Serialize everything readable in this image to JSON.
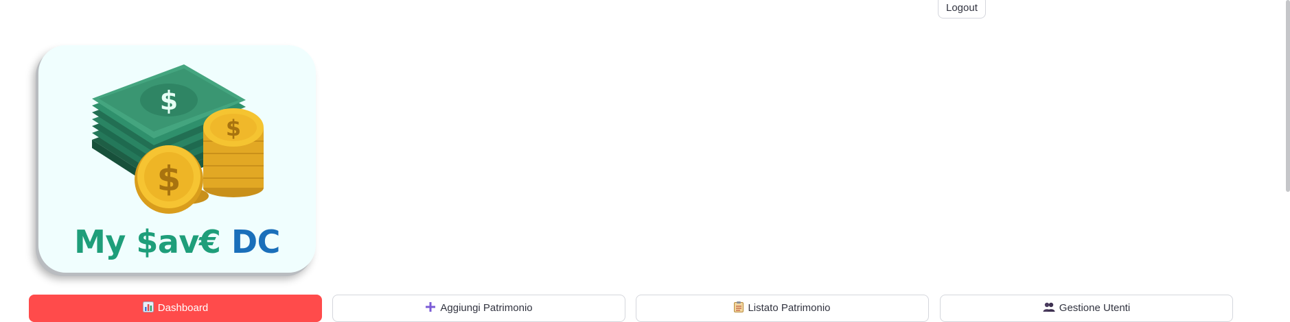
{
  "header": {
    "logout_label": "Logout"
  },
  "logo": {
    "part1": "My",
    "part2": "$av€",
    "part3": "DC"
  },
  "nav": [
    {
      "label": "Dashboard",
      "icon": "bar-chart-icon",
      "active": true
    },
    {
      "label": "Aggiungi Patrimonio",
      "icon": "plus-icon"
    },
    {
      "label": "Listato Patrimonio",
      "icon": "clipboard-icon"
    },
    {
      "label": "Gestione Utenti",
      "icon": "users-icon"
    }
  ],
  "colors": {
    "primary": "#ff4b4b",
    "logo_green": "#1e9e7a",
    "logo_blue": "#1a6fba"
  }
}
